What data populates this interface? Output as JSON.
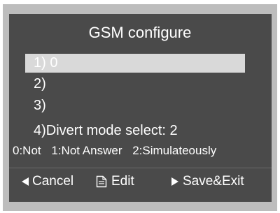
{
  "screen": {
    "title": "GSM configure"
  },
  "menu": {
    "items": [
      {
        "label": "1)  0"
      },
      {
        "label": "2)"
      },
      {
        "label": "3)"
      },
      {
        "label": "4)Divert mode select: 2"
      }
    ]
  },
  "divert_options": [
    "0:Not",
    "1:Not Answer",
    "2:Simulateously"
  ],
  "softkeys": {
    "cancel": {
      "label": "Cancel",
      "icon": "left-arrow-icon"
    },
    "edit": {
      "label": "Edit",
      "icon": "document-icon"
    },
    "save": {
      "label": "Save&Exit",
      "icon": "right-arrow-icon"
    }
  },
  "colors": {
    "screen_bg": "#4a4a4a",
    "bezel": "#bdbdbd",
    "highlight": "#d9d9d9",
    "text": "#ffffff"
  }
}
